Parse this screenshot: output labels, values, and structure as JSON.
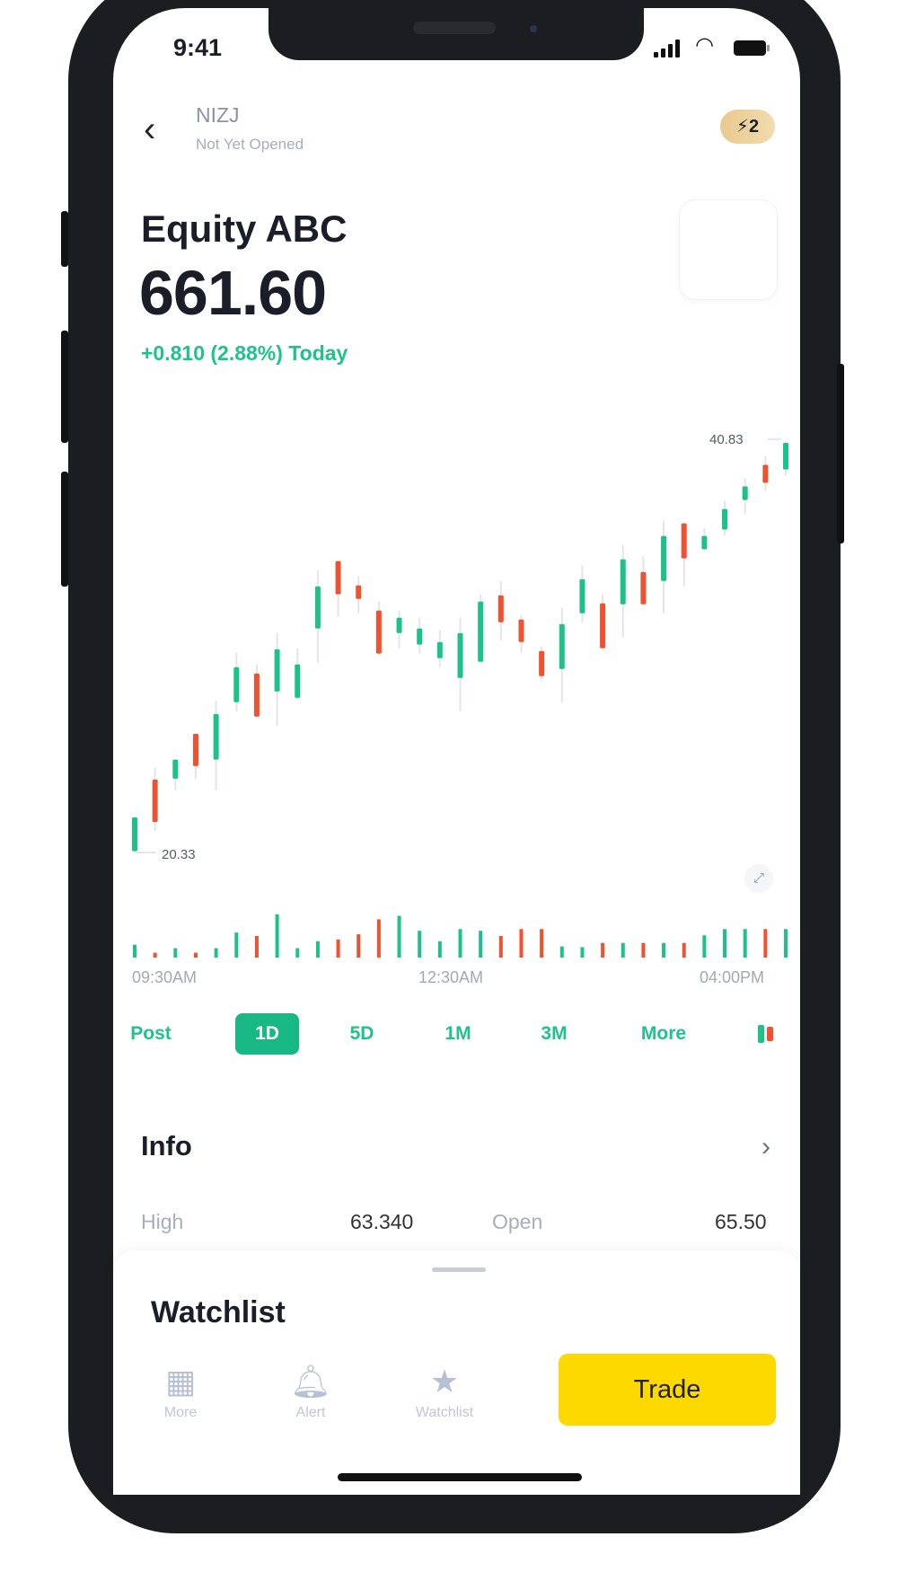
{
  "status_bar": {
    "time": "9:41"
  },
  "header": {
    "symbol": "NIZJ",
    "market_status": "Not Yet Opened",
    "badge": "⚡2"
  },
  "quote": {
    "name": "Equity ABC",
    "price": "661.60",
    "change": "+0.810 (2.88%) Today"
  },
  "tool_icons": [
    {
      "name": "draw-tool-icon",
      "color": "#f0455a",
      "glyph": "✎"
    },
    {
      "name": "compare-icon",
      "color": "#6a63f0",
      "glyph": "⇥"
    },
    {
      "name": "indicator-icon",
      "color": "#4c6ef5",
      "glyph": "▣"
    },
    {
      "name": "alert-tool-icon",
      "color": "#f56a12",
      "glyph": "♎"
    }
  ],
  "colors": {
    "up": "#1cc28a",
    "down": "#f0522f",
    "accent": "#18b884",
    "trade": "#fdd900"
  },
  "chart_data": {
    "type": "candlestick",
    "high_label": "40.83",
    "low_label": "20.33",
    "x_tick_labels": [
      "09:30AM",
      "12:30AM",
      "04:00PM"
    ],
    "ylim": [
      20.33,
      40.83
    ],
    "candles": [
      [
        20.4,
        22.09,
        22.09,
        20.33
      ],
      [
        23.98,
        21.86,
        24.56,
        21.41
      ],
      [
        24.02,
        24.98,
        24.98,
        23.44
      ],
      [
        26.27,
        24.65,
        26.27,
        24.02
      ],
      [
        24.98,
        27.26,
        27.94,
        23.44
      ],
      [
        27.85,
        29.6,
        30.32,
        27.4
      ],
      [
        29.29,
        27.13,
        29.74,
        27.13
      ],
      [
        28.39,
        30.5,
        31.31,
        26.68
      ],
      [
        28.07,
        29.74,
        30.55,
        28.07
      ],
      [
        31.54,
        33.65,
        34.46,
        29.83
      ],
      [
        34.91,
        33.25,
        34.91,
        32.12
      ],
      [
        33.7,
        33.02,
        34.15,
        32.3
      ],
      [
        32.44,
        30.28,
        32.89,
        30.28
      ],
      [
        31.31,
        32.08,
        32.44,
        30.55
      ],
      [
        30.73,
        31.54,
        32.08,
        30.28
      ],
      [
        30.05,
        30.86,
        31.45,
        29.6
      ],
      [
        29.06,
        31.31,
        32.08,
        27.4
      ],
      [
        29.87,
        32.89,
        33.25,
        29.87
      ],
      [
        33.2,
        31.85,
        33.92,
        30.95
      ],
      [
        31.99,
        30.86,
        32.21,
        30.32
      ],
      [
        30.41,
        29.15,
        30.64,
        28.93
      ],
      [
        29.51,
        31.76,
        32.57,
        27.85
      ],
      [
        32.3,
        34.01,
        34.69,
        31.85
      ],
      [
        32.8,
        30.55,
        33.25,
        30.55
      ],
      [
        32.75,
        35.0,
        35.72,
        31.09
      ],
      [
        34.37,
        32.75,
        35.14,
        32.75
      ],
      [
        33.92,
        36.17,
        36.94,
        32.3
      ],
      [
        36.8,
        35.05,
        36.8,
        33.65
      ],
      [
        35.5,
        36.17,
        36.58,
        35.5
      ],
      [
        36.49,
        37.52,
        37.93,
        36.17
      ],
      [
        37.97,
        38.65,
        39.05,
        37.25
      ],
      [
        39.73,
        38.83,
        40.18,
        38.42
      ],
      [
        39.5,
        40.83,
        40.83,
        39.19
      ]
    ],
    "candle_fields": [
      "open",
      "close",
      "high",
      "low"
    ],
    "volume": [
      37,
      14,
      27,
      14,
      27,
      72,
      62,
      124,
      27,
      47,
      52,
      67,
      110,
      120,
      77,
      47,
      82,
      77,
      62,
      82,
      82,
      32,
      30,
      42,
      42,
      42,
      42,
      42,
      64,
      82,
      82,
      82,
      82
    ]
  },
  "ranges": {
    "items": [
      "Post",
      "1D",
      "5D",
      "1M",
      "3M",
      "More"
    ],
    "active": "1D"
  },
  "info": {
    "title": "Info",
    "rows": [
      {
        "label": "High",
        "value": "63.340"
      },
      {
        "label": "Open",
        "value": "65.50"
      }
    ]
  },
  "sheet": {
    "title": "Watchlist"
  },
  "bottom_nav": [
    {
      "label": "More",
      "icon": "grid-icon"
    },
    {
      "label": "Alert",
      "icon": "bell-icon"
    },
    {
      "label": "Watchlist",
      "icon": "star-icon"
    }
  ],
  "trade_label": "Trade"
}
